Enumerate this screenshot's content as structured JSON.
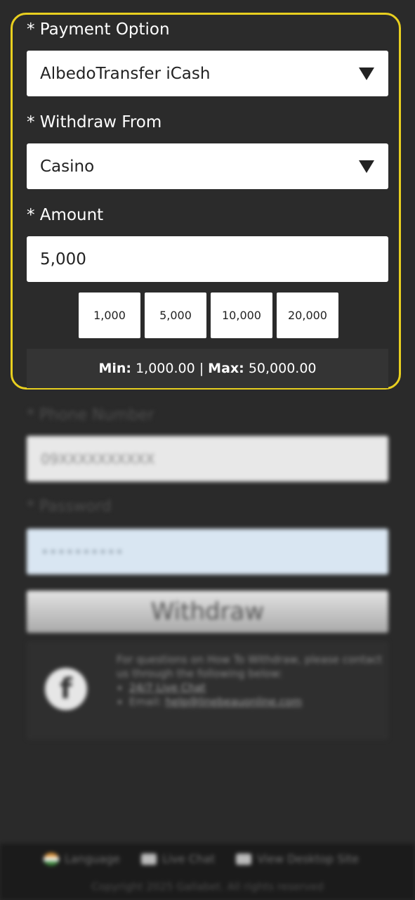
{
  "payment_option": {
    "label": "* Payment Option",
    "selected": "AlbedoTransfer iCash"
  },
  "withdraw_from": {
    "label": "* Withdraw From",
    "selected": "Casino"
  },
  "amount": {
    "label": "* Amount",
    "value": "5,000",
    "quick_amounts": [
      "1,000",
      "5,000",
      "10,000",
      "20,000"
    ]
  },
  "limits": {
    "min_label": "Min:",
    "min_value": "1,000.00",
    "separator": "|",
    "max_label": "Max:",
    "max_value": "50,000.00"
  },
  "phone": {
    "label": "* Phone Number",
    "value": "09XXXXXXXXXX"
  },
  "password": {
    "label": "* Password",
    "value": "••••••••••"
  },
  "withdraw_button": "Withdraw",
  "help": {
    "intro": "For questions on How To Withdraw, please contact us through the following below:",
    "live_chat": "24/7 Live Chat",
    "email_label": "Email:",
    "email": "help@linebeauonline.com"
  },
  "footer": {
    "language": "Language",
    "live_chat": "Live Chat",
    "desktop": "View Desktop Site",
    "copyright": "Copyright 2025 Gallabet. All rights reserved"
  },
  "colors": {
    "highlight_border": "#e8cf1f",
    "background": "#2a2a2a"
  }
}
